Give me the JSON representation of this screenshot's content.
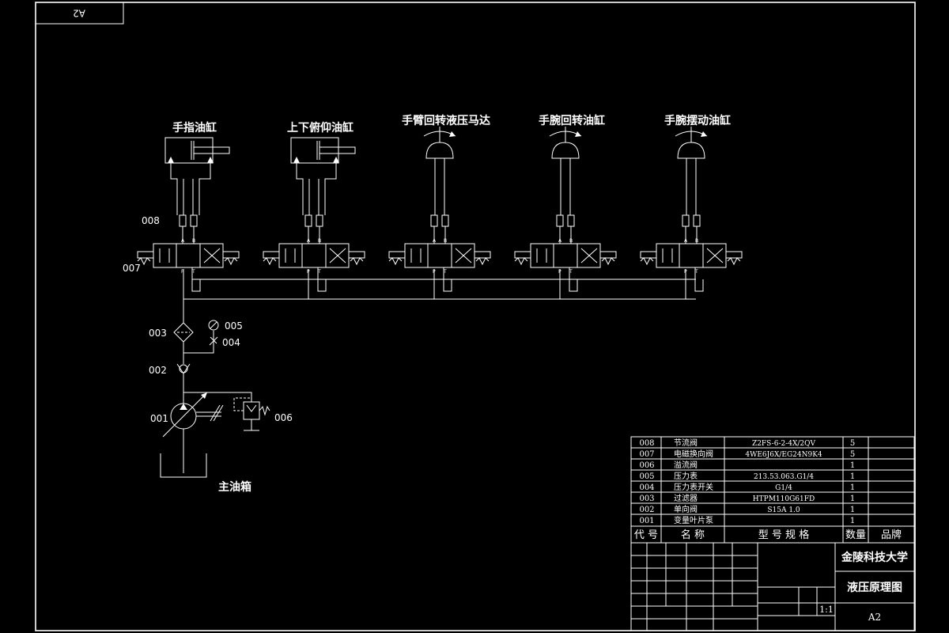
{
  "frame": {
    "sheet_tag": "A2"
  },
  "actuators": [
    {
      "label": "手指油缸",
      "kind": "cylinder"
    },
    {
      "label": "上下俯仰油缸",
      "kind": "cylinder"
    },
    {
      "label": "手臂回转液压马达",
      "kind": "motor"
    },
    {
      "label": "手腕回转油缸",
      "kind": "motor"
    },
    {
      "label": "手腕摆动油缸",
      "kind": "motor"
    }
  ],
  "valve_port_labels": {
    "A": "A",
    "B": "B",
    "P": "P",
    "T": "T"
  },
  "callouts": {
    "c008": "008",
    "c007": "007",
    "c003": "003",
    "c005": "005",
    "c004": "004",
    "c002": "002",
    "c001": "001",
    "c006": "006"
  },
  "tank_label": "主油箱",
  "bom": {
    "rows": [
      {
        "code": "008",
        "name": "节流阀",
        "model": "Z2FS-6-2-4X/2QV",
        "qty": "5",
        "brand": ""
      },
      {
        "code": "007",
        "name": "电磁换向阀",
        "model": "4WE6J6X/EG24N9K4",
        "qty": "5",
        "brand": ""
      },
      {
        "code": "006",
        "name": "溢流阀",
        "model": "",
        "qty": "1",
        "brand": ""
      },
      {
        "code": "005",
        "name": "压力表",
        "model": "213.53.063.G1/4",
        "qty": "1",
        "brand": ""
      },
      {
        "code": "004",
        "name": "压力表开关",
        "model": "G1/4",
        "qty": "1",
        "brand": ""
      },
      {
        "code": "003",
        "name": "过滤器",
        "model": "HTPM110G61FD",
        "qty": "1",
        "brand": ""
      },
      {
        "code": "002",
        "name": "单向阀",
        "model": "S15A 1.0",
        "qty": "1",
        "brand": ""
      },
      {
        "code": "001",
        "name": "变量叶片泵",
        "model": "",
        "qty": "1",
        "brand": ""
      }
    ],
    "header": {
      "code": "代 号",
      "name": "名 称",
      "model": "型 号 规 格",
      "qty": "数量",
      "brand": "品牌"
    }
  },
  "title_block": {
    "school": "金陵科技大学",
    "drawing_title": "液压原理图",
    "scale": "1:1",
    "sheet": "A2"
  }
}
